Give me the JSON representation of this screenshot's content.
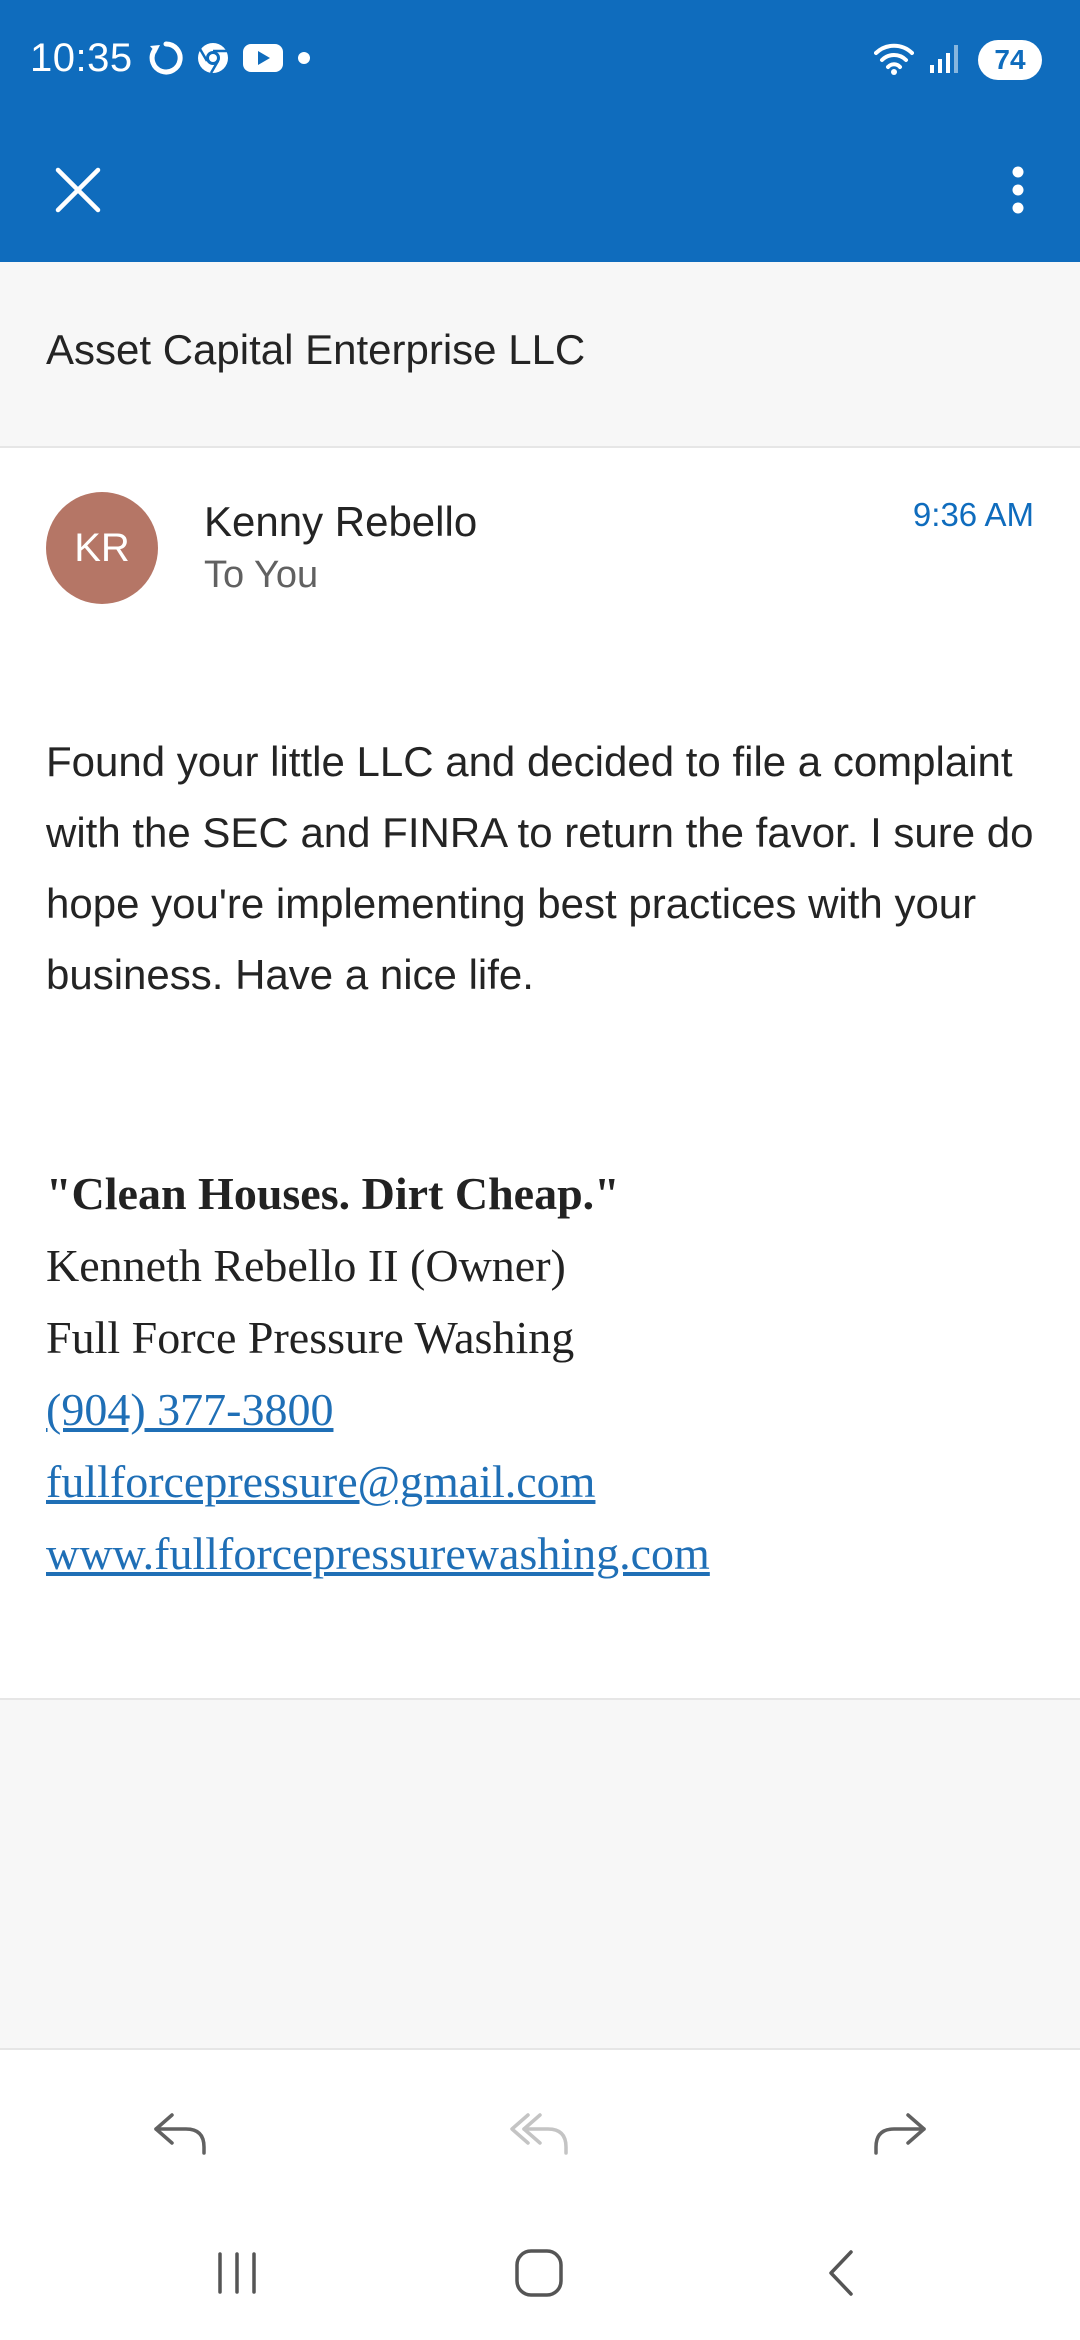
{
  "status_bar": {
    "time": "10:35",
    "battery": "74",
    "icons_left": [
      "sync-icon",
      "chrome-icon",
      "youtube-icon",
      "dot-icon"
    ],
    "icons_right": [
      "wifi-icon",
      "signal-icon",
      "battery-icon"
    ]
  },
  "toolbar": {
    "close_icon": "close-icon",
    "more_icon": "more-vertical-icon"
  },
  "subject": "Asset Capital Enterprise LLC",
  "message": {
    "avatar_initials": "KR",
    "avatar_color": "#b57666",
    "sender": "Kenny Rebello",
    "recipient": "To You",
    "time": "9:36 AM",
    "body": "Found your little LLC and decided to file a complaint with the SEC and FINRA to return the favor. I sure do hope you're implementing best practices with your business. Have a nice life.",
    "signature": {
      "slogan": "\"Clean Houses. Dirt Cheap.\"",
      "name": "Kenneth Rebello II (Owner)",
      "company": "Full Force Pressure Washing",
      "phone": "(904) 377-3800",
      "email": "fullforcepressure@gmail.com",
      "website": "www.fullforcepressurewashing.com"
    }
  },
  "actions": {
    "reply_icon": "reply-icon",
    "reply_all_icon": "reply-all-icon",
    "forward_icon": "forward-icon"
  },
  "nav": {
    "recents_icon": "recents-icon",
    "home_icon": "home-icon",
    "back_icon": "back-icon"
  },
  "colors": {
    "header_blue": "#0f6cbd",
    "link_blue": "#1f6fb6",
    "background_grey": "#f7f7f7"
  }
}
